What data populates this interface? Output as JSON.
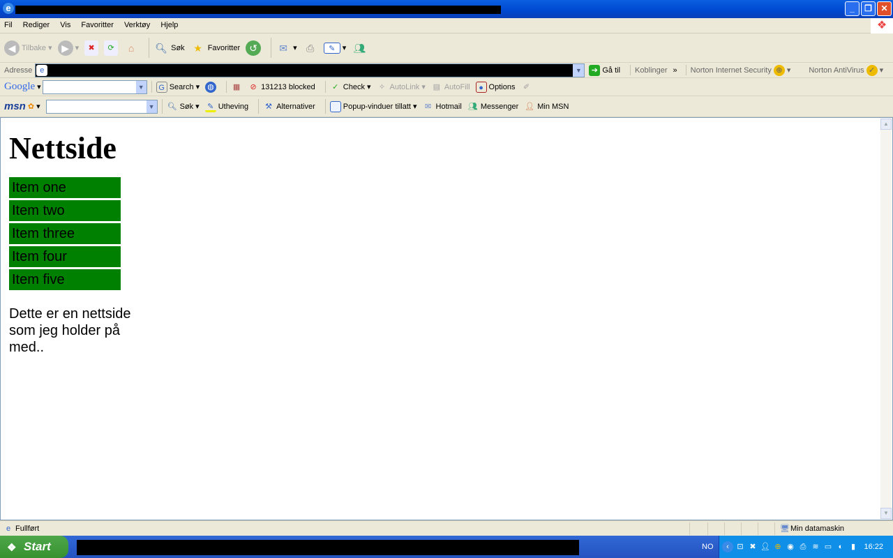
{
  "menu": [
    "Fil",
    "Rediger",
    "Vis",
    "Favoritter",
    "Verktøy",
    "Hjelp"
  ],
  "toolbar": {
    "back": "Tilbake",
    "search": "Søk",
    "favorites": "Favoritter"
  },
  "address": {
    "label": "Adresse",
    "go": "Gå til",
    "links": "Koblinger",
    "nis": "Norton Internet Security",
    "nav": "Norton AntiVirus"
  },
  "google": {
    "logo": "Google",
    "search": "Search",
    "blocked": "131213 blocked",
    "check": "Check",
    "autolink": "AutoLink",
    "autofill": "AutoFill",
    "options": "Options"
  },
  "msn": {
    "logo": "msn",
    "search": "Søk",
    "highlight": "Utheving",
    "alternatives": "Alternativer",
    "popups": "Popup-vinduer tillatt",
    "hotmail": "Hotmail",
    "messenger": "Messenger",
    "my_msn": "Min MSN"
  },
  "page": {
    "title": "Nettside",
    "items": [
      "Item one",
      "Item two",
      "Item three",
      "Item four",
      "Item five"
    ],
    "paragraph": "Dette er en nettside som jeg holder på med..",
    "item_color": "#008000"
  },
  "status": {
    "text": "Fullført",
    "zone": "Min datamaskin"
  },
  "taskbar": {
    "start": "Start",
    "lang": "NO",
    "clock": "16:22"
  }
}
